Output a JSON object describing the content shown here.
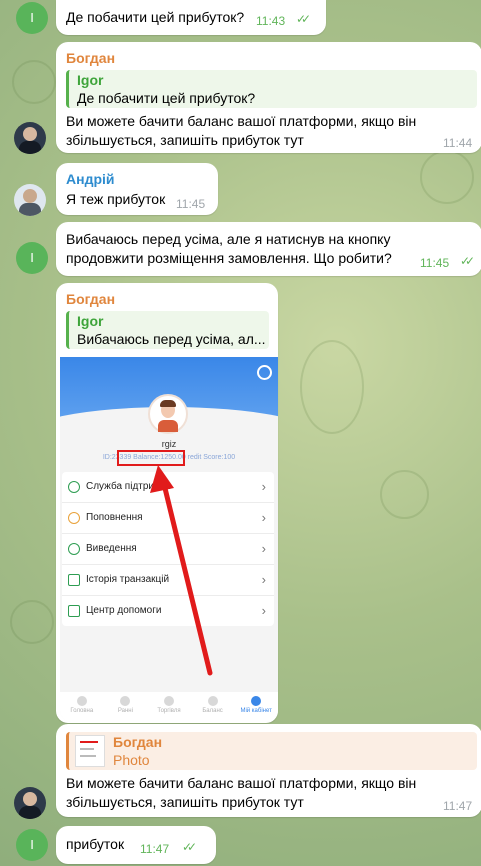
{
  "messages": {
    "m1": {
      "avatar": "I",
      "text": "Де побачити цей прибуток?",
      "time": "11:43"
    },
    "m2": {
      "sender": "Богдан",
      "quote_name": "Igor",
      "quote_text": "Де побачити цей прибуток?",
      "text": "Ви можете бачити баланс вашої платформи, якщо він збільшується, запишіть прибуток тут",
      "time": "11:44"
    },
    "m3": {
      "sender": "Андрій",
      "text": "Я теж прибуток",
      "time": "11:45"
    },
    "m4": {
      "avatar": "I",
      "text": "Вибачаюсь перед усіма, але я натиснув на кнопку продовжити розміщення замовлення. Що робити?",
      "time": "11:45"
    },
    "m5": {
      "sender": "Богдан",
      "quote_name": "Igor",
      "quote_text": "Вибачаюсь перед усіма, ал...",
      "shot": {
        "username": "rgiz",
        "info": "ID:23339  Balance:1250.00  redit Score:100",
        "menu": [
          "Служба підтримки",
          "Поповнення",
          "Виведення",
          "Історія транзакцій",
          "Центр допомоги"
        ],
        "tabs": [
          "Головна",
          "Ранні",
          "Торгівля",
          "Баланс",
          "Мій кабінет"
        ]
      }
    },
    "m6": {
      "quote_name": "Богдан",
      "quote_text": "Photo",
      "text": "Ви можете бачити баланс вашої платформи, якщо він збільшується, запишіть прибуток тут",
      "time": "11:47"
    },
    "m7": {
      "avatar": "I",
      "text": "прибуток",
      "time": "11:47"
    }
  },
  "colors": {
    "accent": "#56b14c",
    "orange": "#e0863d",
    "blue_name": "#2e8ccf",
    "highlight": "#e11b1b"
  },
  "icons": [
    "double-check-icon",
    "gear-icon",
    "red-arrow-annotation"
  ]
}
